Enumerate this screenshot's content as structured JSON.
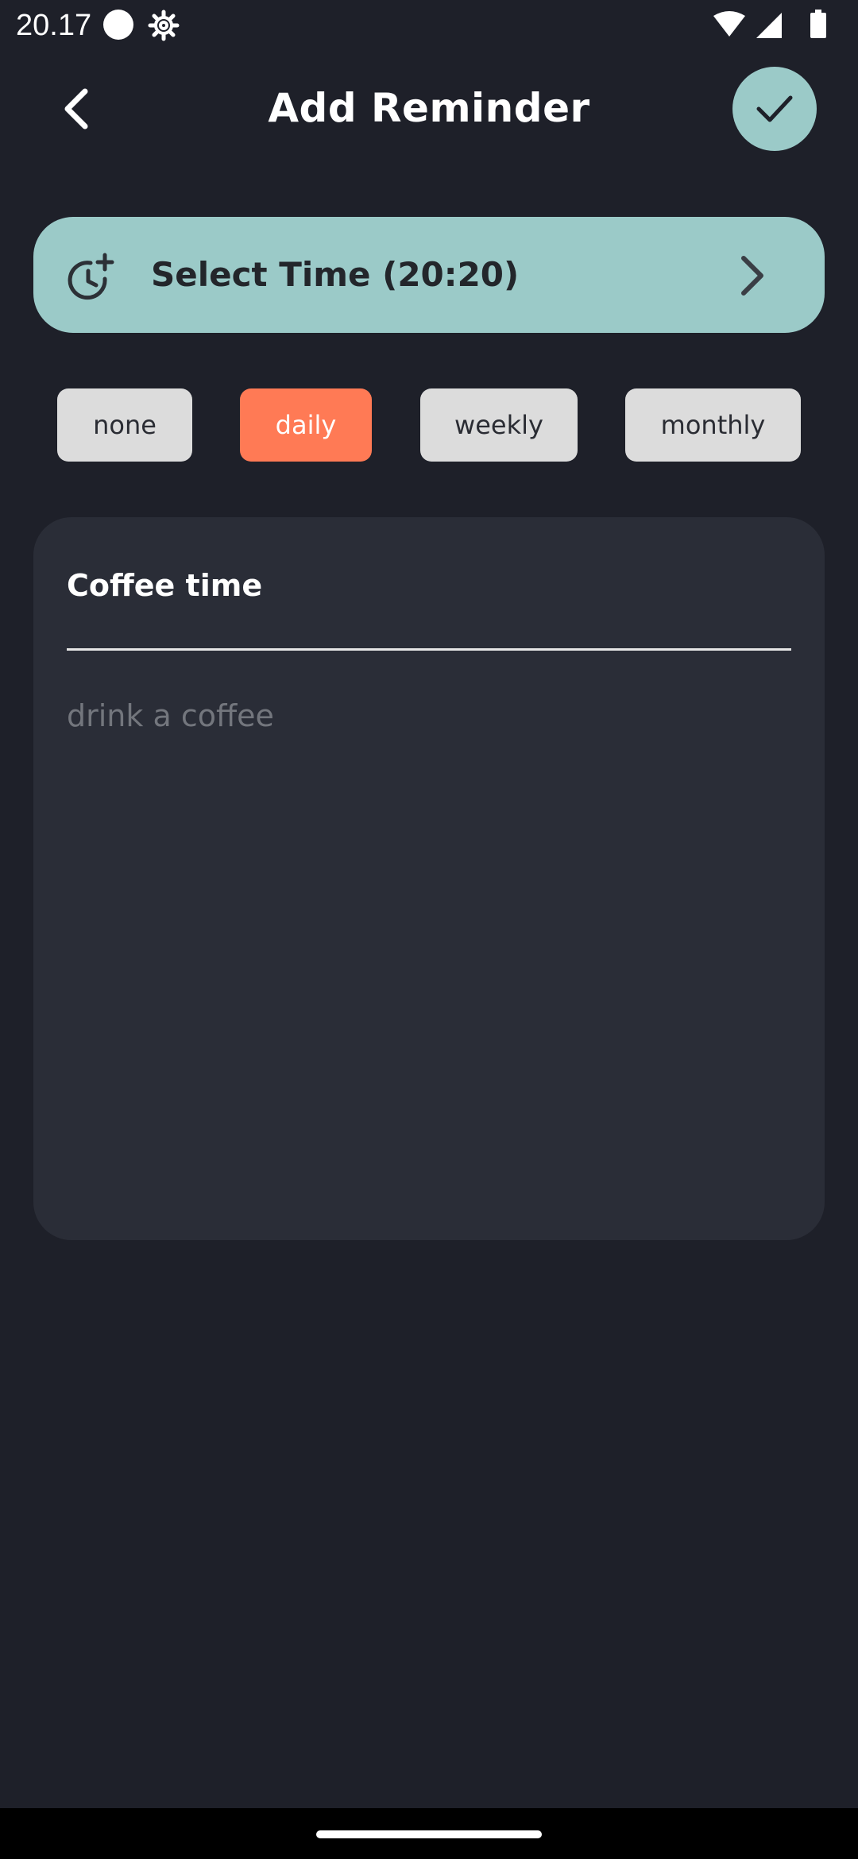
{
  "status_bar": {
    "time": "20.17",
    "icons": [
      "circle-icon",
      "gear-icon",
      "wifi-icon",
      "signal-icon",
      "battery-icon"
    ]
  },
  "header": {
    "title": "Add Reminder",
    "back_icon": "chevron-left-icon",
    "confirm_icon": "check-icon"
  },
  "time_selector": {
    "label": "Select Time (20:20)",
    "icon": "clock-plus-icon",
    "arrow_icon": "chevron-right-icon"
  },
  "repeat": {
    "options": [
      {
        "label": "none",
        "selected": false
      },
      {
        "label": "daily",
        "selected": true
      },
      {
        "label": "weekly",
        "selected": false
      },
      {
        "label": "monthly",
        "selected": false
      }
    ]
  },
  "note": {
    "title": "Coffee time",
    "body_placeholder": "drink a coffee"
  },
  "colors": {
    "background": "#1e2029",
    "accent_teal": "#9bcac8",
    "accent_orange": "#ff7a55",
    "card": "#2a2d37"
  }
}
